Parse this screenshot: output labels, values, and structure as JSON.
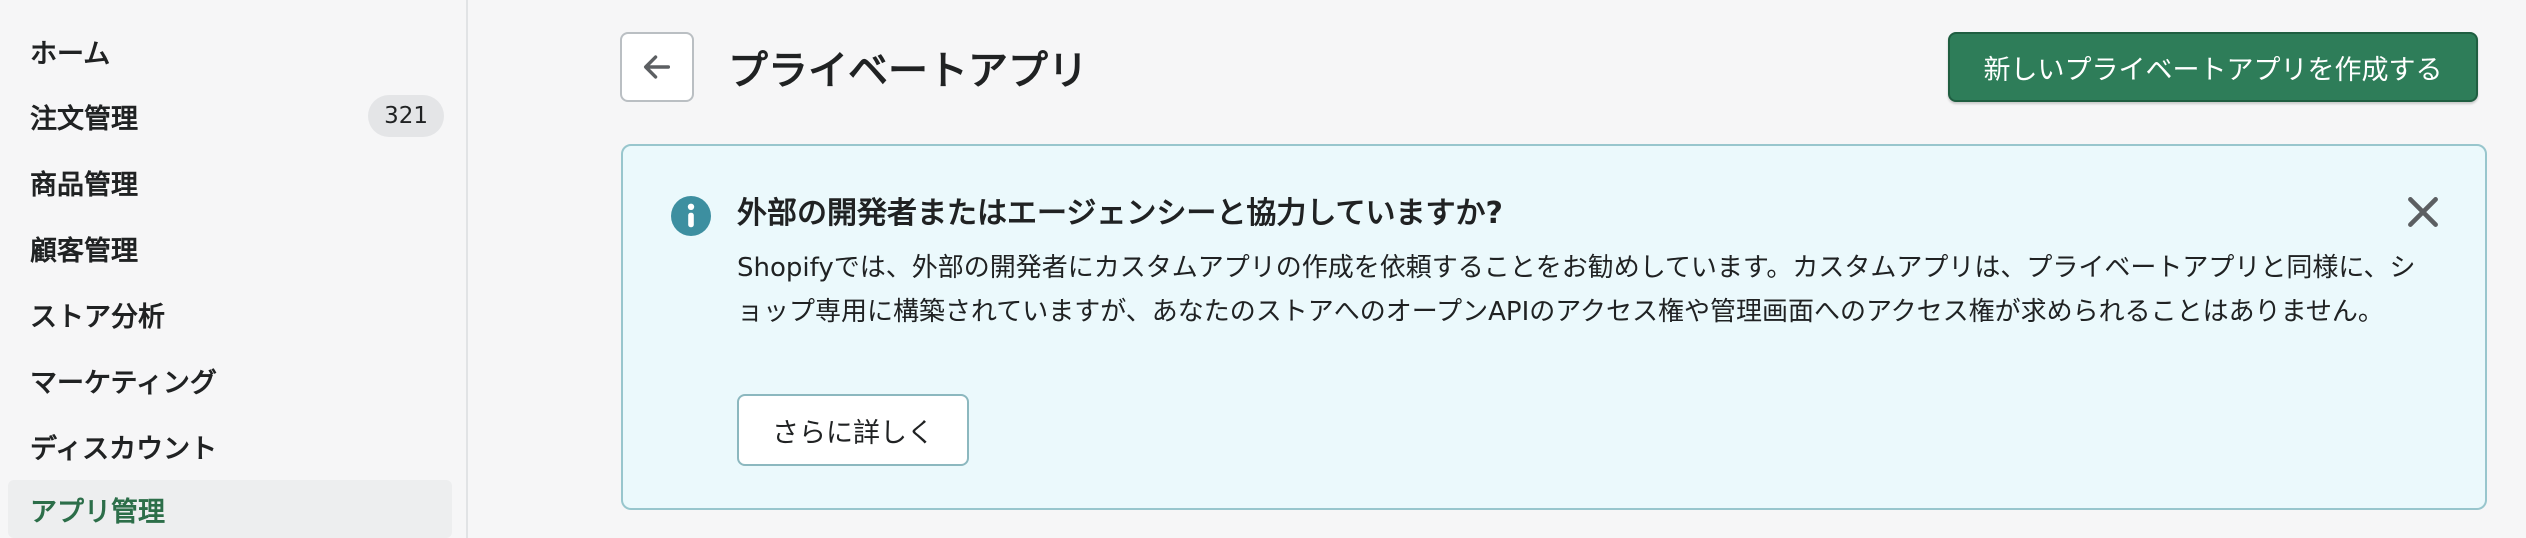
{
  "sidebar": {
    "items": [
      {
        "label": "ホーム"
      },
      {
        "label": "注文管理",
        "badge": "321"
      },
      {
        "label": "商品管理"
      },
      {
        "label": "顧客管理"
      },
      {
        "label": "ストア分析"
      },
      {
        "label": "マーケティング"
      },
      {
        "label": "ディスカウント"
      },
      {
        "label": "アプリ管理",
        "active": true
      }
    ]
  },
  "header": {
    "back_icon": "arrow-left-icon",
    "title": "プライベートアプリ",
    "primary_action": "新しいプライベートアプリを作成する"
  },
  "banner": {
    "icon": "info-icon",
    "title": "外部の開発者またはエージェンシーと協力していますか?",
    "body": "Shopifyでは、外部の開発者にカスタムアプリの作成を依頼することをお勧めしています。カスタムアプリは、プライベートアプリと同様に、ショップ専用に構築されていますが、あなたのストアへのオープンAPIのアクセス権や管理画面へのアクセス権が求められることはありません。",
    "action": "さらに詳しく",
    "close_icon": "close-icon"
  },
  "colors": {
    "primary": "#2e7d59",
    "active_nav_text": "#2c6e49",
    "info_icon": "#3d8fa0",
    "banner_bg": "#ebf9fc",
    "banner_border": "#98c6cd"
  }
}
